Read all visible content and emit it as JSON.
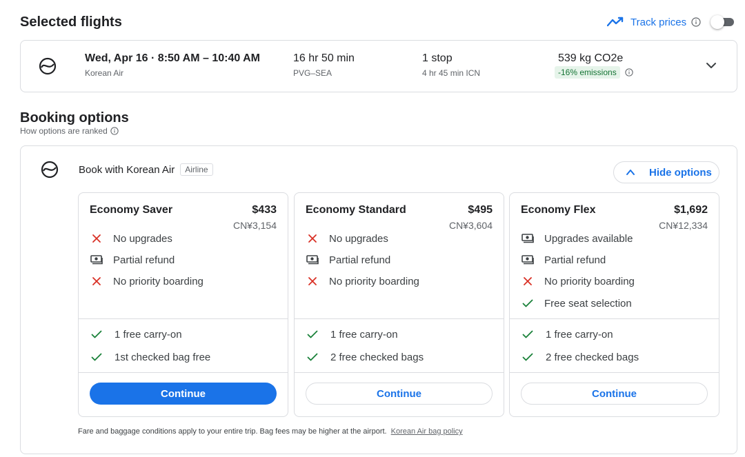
{
  "header": {
    "title": "Selected flights",
    "track_prices_label": "Track prices",
    "track_prices_on": false
  },
  "flight": {
    "airline": "Korean Air",
    "date_time": "Wed, Apr 16 · 8:50 AM – 10:40 AM",
    "duration": "16 hr 50 min",
    "route": "PVG–SEA",
    "stops": "1 stop",
    "layover": "4 hr 45 min ICN",
    "emissions": "539 kg CO2e",
    "emissions_badge": "-16% emissions"
  },
  "booking": {
    "title": "Booking options",
    "ranked_label": "How options are ranked",
    "book_with": "Book with Korean Air",
    "seller_badge": "Airline",
    "hide_options_label": "Hide options",
    "footer_text": "Fare and baggage conditions apply to your entire trip. Bag fees may be higher at the airport.",
    "policy_link": "Korean Air bag policy",
    "fares": [
      {
        "name": "Economy Saver",
        "price": "$433",
        "price_cny": "CN¥3,154",
        "features": [
          {
            "icon": "x-icon",
            "label": "No upgrades"
          },
          {
            "icon": "money-icon",
            "label": "Partial refund"
          },
          {
            "icon": "x-icon",
            "label": "No priority boarding"
          }
        ],
        "bags": [
          {
            "icon": "check-icon",
            "label": "1 free carry-on"
          },
          {
            "icon": "check-icon",
            "label": "1st checked bag free"
          }
        ],
        "button": "Continue",
        "primary": true
      },
      {
        "name": "Economy Standard",
        "price": "$495",
        "price_cny": "CN¥3,604",
        "features": [
          {
            "icon": "x-icon",
            "label": "No upgrades"
          },
          {
            "icon": "money-icon",
            "label": "Partial refund"
          },
          {
            "icon": "x-icon",
            "label": "No priority boarding"
          }
        ],
        "bags": [
          {
            "icon": "check-icon",
            "label": "1 free carry-on"
          },
          {
            "icon": "check-icon",
            "label": "2 free checked bags"
          }
        ],
        "button": "Continue",
        "primary": false
      },
      {
        "name": "Economy Flex",
        "price": "$1,692",
        "price_cny": "CN¥12,334",
        "features": [
          {
            "icon": "money-icon",
            "label": "Upgrades available"
          },
          {
            "icon": "money-icon",
            "label": "Partial refund"
          },
          {
            "icon": "x-icon",
            "label": "No priority boarding"
          },
          {
            "icon": "check-icon",
            "label": "Free seat selection"
          }
        ],
        "bags": [
          {
            "icon": "check-icon",
            "label": "1 free carry-on"
          },
          {
            "icon": "check-icon",
            "label": "2 free checked bags"
          }
        ],
        "button": "Continue",
        "primary": false
      }
    ]
  },
  "colors": {
    "accent": "#1a73e8",
    "red_x": "#d93025",
    "green_check": "#188038",
    "emissions_bg": "#e6f4ea",
    "emissions_fg": "#137333",
    "border": "#dadce0"
  }
}
